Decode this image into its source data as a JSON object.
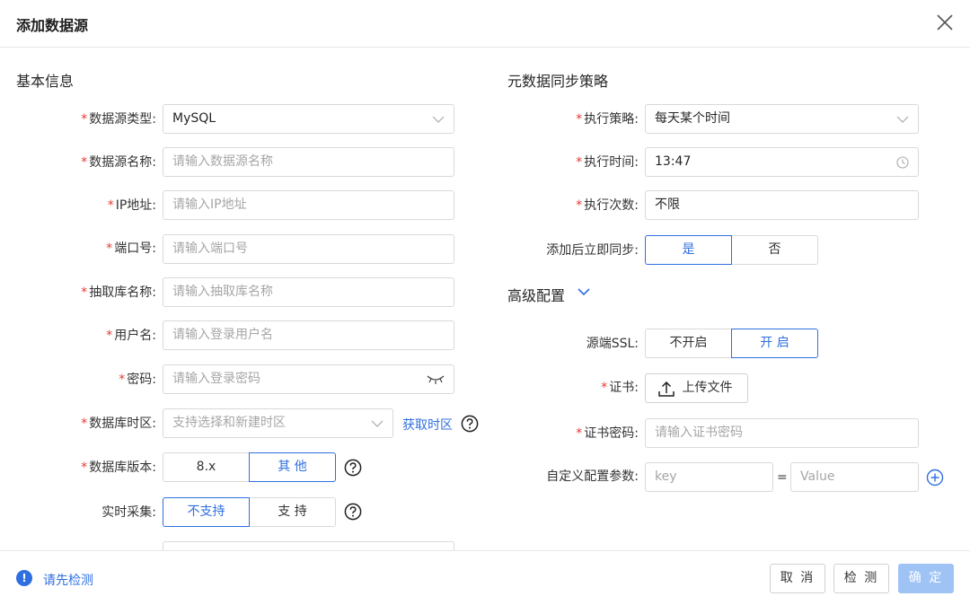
{
  "dialog": {
    "title": "添加数据源"
  },
  "basic": {
    "section_title": "基本信息",
    "datasource_type": {
      "label": "数据源类型:",
      "value": "MySQL"
    },
    "datasource_name": {
      "label": "数据源名称:",
      "placeholder": "请输入数据源名称"
    },
    "ip": {
      "label": "IP地址:",
      "placeholder": "请输入IP地址"
    },
    "port": {
      "label": "端口号:",
      "placeholder": "请输入端口号"
    },
    "db_name": {
      "label": "抽取库名称:",
      "placeholder": "请输入抽取库名称"
    },
    "username": {
      "label": "用户名:",
      "placeholder": "请输入登录用户名"
    },
    "password": {
      "label": "密码:",
      "placeholder": "请输入登录密码"
    },
    "timezone": {
      "label": "数据库时区:",
      "placeholder": "支持选择和新建时区",
      "link": "获取时区"
    },
    "version": {
      "label": "数据库版本:",
      "options": [
        "8.x",
        "其 他"
      ],
      "selected": "其 他"
    },
    "realtime": {
      "label": "实时采集:",
      "options": [
        "不支持",
        "支 持"
      ],
      "selected": "不支持"
    }
  },
  "sync": {
    "section_title": "元数据同步策略",
    "strategy": {
      "label": "执行策略:",
      "value": "每天某个时间"
    },
    "time": {
      "label": "执行时间:",
      "value": "13:47"
    },
    "count": {
      "label": "执行次数:",
      "value": "不限"
    },
    "sync_now": {
      "label": "添加后立即同步:",
      "options": [
        "是",
        "否"
      ],
      "selected": "是"
    }
  },
  "advanced": {
    "section_title": "高级配置",
    "ssl": {
      "label": "源端SSL:",
      "options": [
        "不开启",
        "开 启"
      ],
      "selected": "开 启"
    },
    "cert": {
      "label": "证书:",
      "button": "上传文件"
    },
    "cert_password": {
      "label": "证书密码:",
      "placeholder": "请输入证书密码"
    },
    "custom_params": {
      "label": "自定义配置参数:",
      "key_placeholder": "key",
      "eq": "=",
      "value_placeholder": "Value"
    }
  },
  "footer": {
    "warning": "请先检测",
    "warning_icon": "!",
    "cancel": "取 消",
    "check": "检 测",
    "confirm": "确 定"
  },
  "colors": {
    "accent": "#2f6fe0",
    "required": "#e53935",
    "confirm_disabled": "#9fc3f5"
  }
}
